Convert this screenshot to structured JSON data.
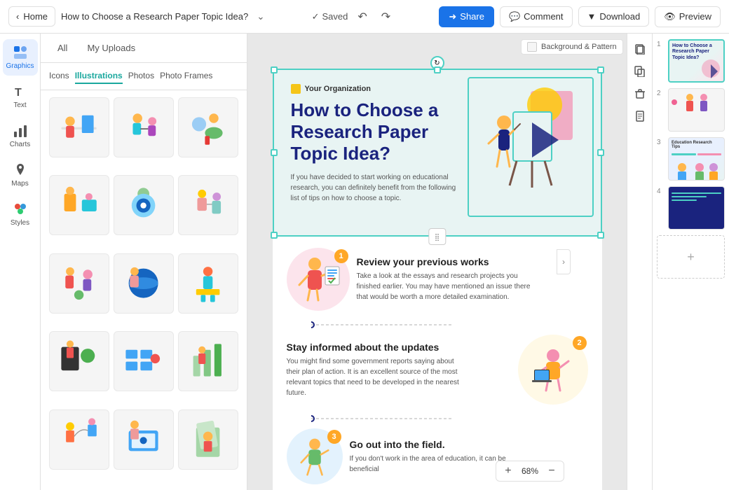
{
  "topbar": {
    "home_label": "Home",
    "doc_title": "How to Choose a  Research Paper Topic Idea?",
    "saved_label": "Saved",
    "share_label": "Share",
    "comment_label": "Comment",
    "download_label": "Download",
    "preview_label": "Preview"
  },
  "sidebar": {
    "items": [
      {
        "id": "graphics",
        "label": "Graphics",
        "active": true
      },
      {
        "id": "text",
        "label": "Text",
        "active": false
      },
      {
        "id": "charts",
        "label": "Charts",
        "active": false
      },
      {
        "id": "maps",
        "label": "Maps",
        "active": false
      },
      {
        "id": "styles",
        "label": "Styles",
        "active": false
      }
    ]
  },
  "assets_panel": {
    "tabs": [
      {
        "id": "all",
        "label": "All",
        "active": false
      },
      {
        "id": "my-uploads",
        "label": "My Uploads",
        "active": false
      }
    ],
    "category_tabs": [
      {
        "id": "icons",
        "label": "Icons",
        "active": false
      },
      {
        "id": "illustrations",
        "label": "Illustrations",
        "active": true
      },
      {
        "id": "photos",
        "label": "Photos",
        "active": false
      },
      {
        "id": "photo-frames",
        "label": "Photo Frames",
        "active": false
      }
    ]
  },
  "slide": {
    "org_label": "Your Organization",
    "hero_title": "How to Choose a Research Paper Topic Idea?",
    "hero_desc": "If you have decided to start working on educational research, you can definitely benefit from the following list of tips on how to choose a topic.",
    "background_pattern_label": "Background & Pattern",
    "step1": {
      "number": "1",
      "title": "Review your previous works",
      "desc": "Take a look at the essays and research projects you finished earlier. You may have mentioned an issue there that would be worth a more detailed examination."
    },
    "step2": {
      "number": "2",
      "title": "Stay informed about the updates",
      "desc": "You might find some government reports saying about their plan of action. It is an excellent source of the most relevant topics that need to be developed in the nearest future."
    },
    "step3": {
      "number": "3",
      "title": "Go out into the field.",
      "desc": "If you don't work in the area of education, it can be beneficial"
    }
  },
  "zoom": {
    "level": "68%",
    "plus_label": "+",
    "minus_label": "−"
  },
  "slides_panel": {
    "slides": [
      {
        "num": "1",
        "active": true
      },
      {
        "num": "2",
        "active": false
      },
      {
        "num": "3",
        "active": false
      },
      {
        "num": "4",
        "active": false
      }
    ],
    "add_label": "+"
  },
  "right_toolbar": {
    "buttons": [
      {
        "id": "copy-style",
        "icon": "⊞"
      },
      {
        "id": "duplicate",
        "icon": "⧉"
      },
      {
        "id": "delete",
        "icon": "🗑"
      },
      {
        "id": "more",
        "icon": "⋮"
      }
    ]
  },
  "colors": {
    "teal": "#1aA89e",
    "teal_light": "#4dd0c4",
    "navy": "#1a237e",
    "share_bg": "#1a73e8",
    "yellow": "#f5c518",
    "pink": "#f06292"
  }
}
